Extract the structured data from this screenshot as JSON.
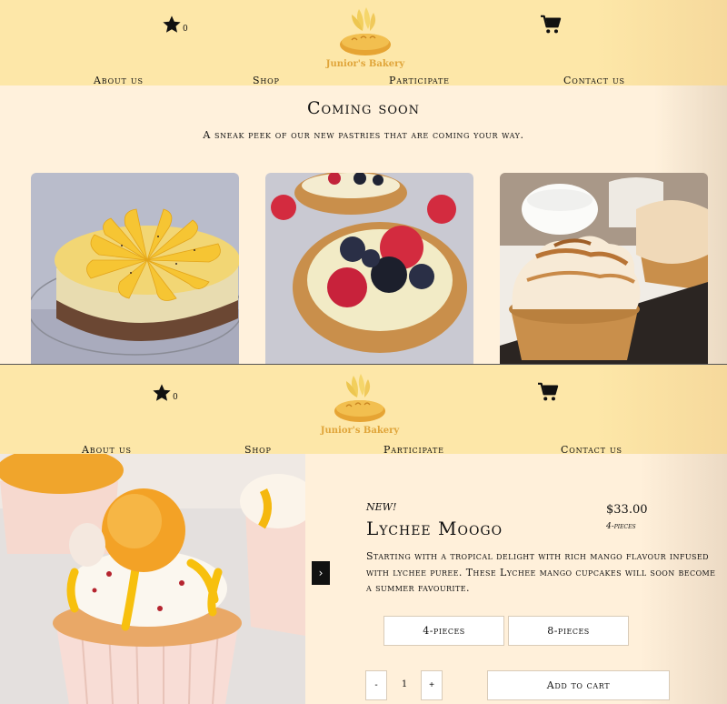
{
  "header": {
    "favorites_count": "0",
    "logo_text": "Junior's Bakery",
    "nav": [
      "About us",
      "Shop",
      "Participate",
      "Contact us"
    ]
  },
  "coming_soon": {
    "title": "Coming soon",
    "subtitle": "A sneak peek of our new pastries that are coming your way.",
    "images": [
      "mango-cheesecake",
      "berry-fruit-tart",
      "meringue-tart"
    ]
  },
  "product": {
    "tag": "NEW!",
    "title": "Lychee Moogo",
    "price": "$33.00",
    "pieces": "4-pieces",
    "description": "Starting with a tropical delight with rich mango flavour infused with lychee puree. These Lychee mango cupcakes will soon become a summer favourite.",
    "options": [
      "4-pieces",
      "8-pieces"
    ],
    "quantity": "1",
    "minus": "-",
    "plus": "+",
    "add_to_cart": "Add to cart",
    "next_icon": "›"
  },
  "colors": {
    "header_bg": "#fde7a8",
    "page_bg": "#fff1dc",
    "logo_gold": "#e0a53a"
  },
  "icons": [
    "star-icon",
    "cart-icon",
    "bread-logo",
    "chevron-right-icon"
  ]
}
